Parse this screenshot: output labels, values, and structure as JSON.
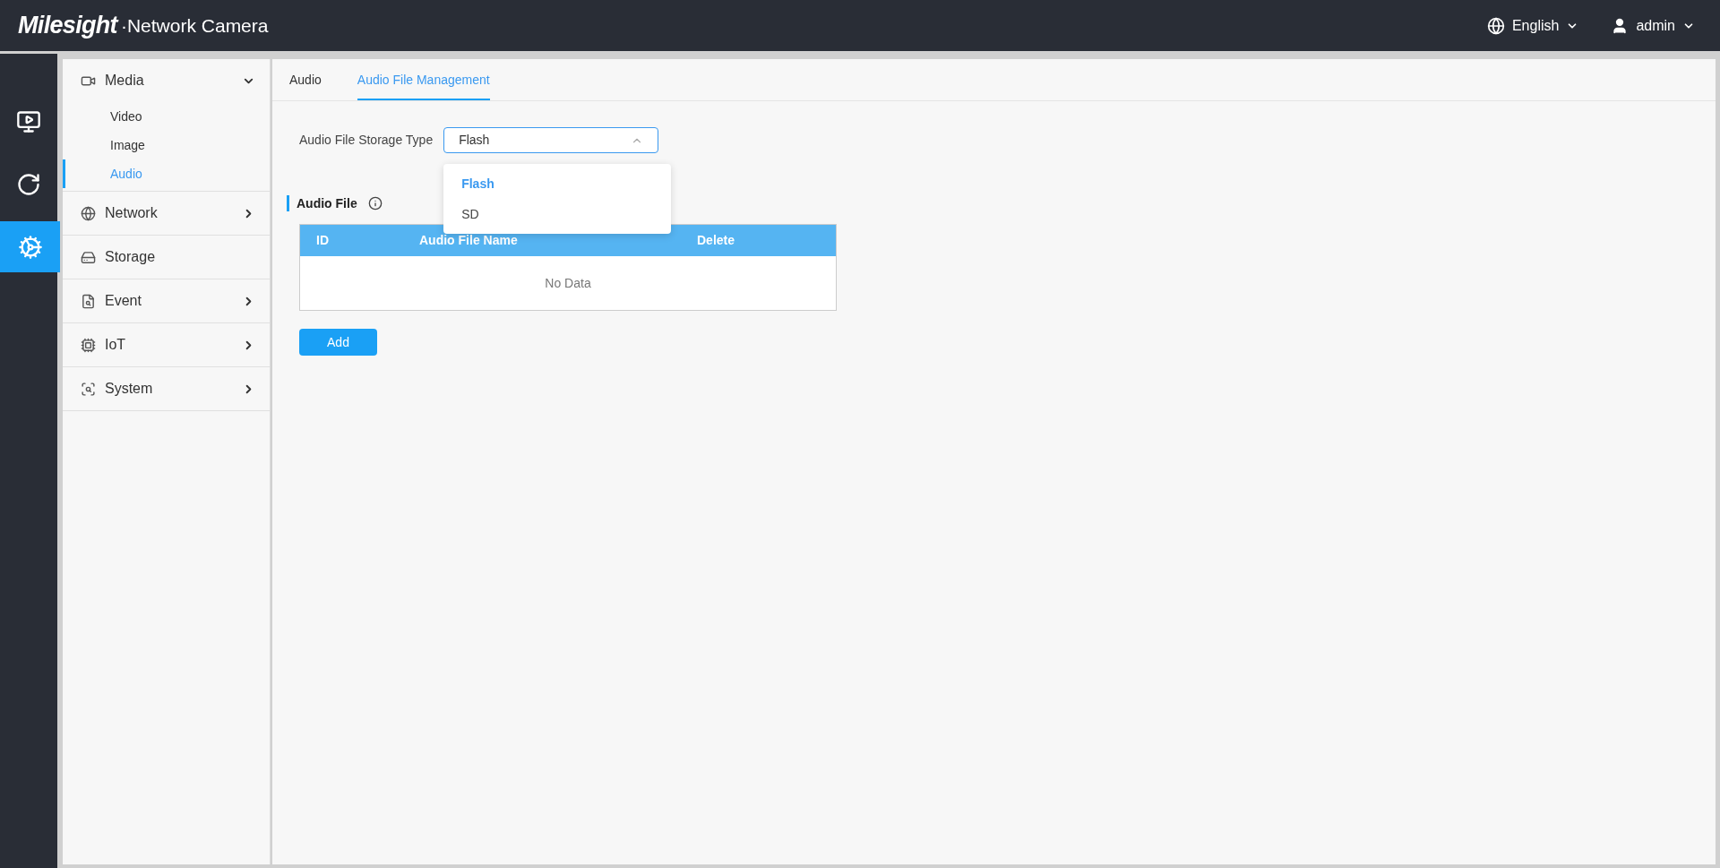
{
  "header": {
    "brand": "Milesight",
    "title": "·Network Camera",
    "language": "English",
    "user": "admin"
  },
  "rail": [
    {
      "kind": "live",
      "selected": false
    },
    {
      "kind": "playback",
      "selected": false
    },
    {
      "kind": "settings",
      "selected": true
    }
  ],
  "sidebar": {
    "items": [
      {
        "label": "Media",
        "kind": "media",
        "expanded": true,
        "children": [
          {
            "label": "Video",
            "selected": false
          },
          {
            "label": "Image",
            "selected": false
          },
          {
            "label": "Audio",
            "selected": true
          }
        ]
      },
      {
        "label": "Network",
        "kind": "network",
        "expanded": false
      },
      {
        "label": "Storage",
        "kind": "storage"
      },
      {
        "label": "Event",
        "kind": "event",
        "expanded": false
      },
      {
        "label": "IoT",
        "kind": "iot",
        "expanded": false
      },
      {
        "label": "System",
        "kind": "system",
        "expanded": false
      }
    ]
  },
  "tabs": [
    {
      "label": "Audio",
      "selected": false
    },
    {
      "label": "Audio File Management",
      "selected": true
    }
  ],
  "storage_type": {
    "label": "Audio File Storage Type",
    "value": "Flash",
    "expanded": true,
    "options": [
      {
        "label": "Flash",
        "selected": true
      },
      {
        "label": "SD",
        "selected": false
      }
    ]
  },
  "section": {
    "title": "Audio File"
  },
  "table": {
    "columns": [
      "ID",
      "Audio File Name",
      "Delete"
    ],
    "empty_text": "No Data"
  },
  "buttons": [
    "Add"
  ]
}
